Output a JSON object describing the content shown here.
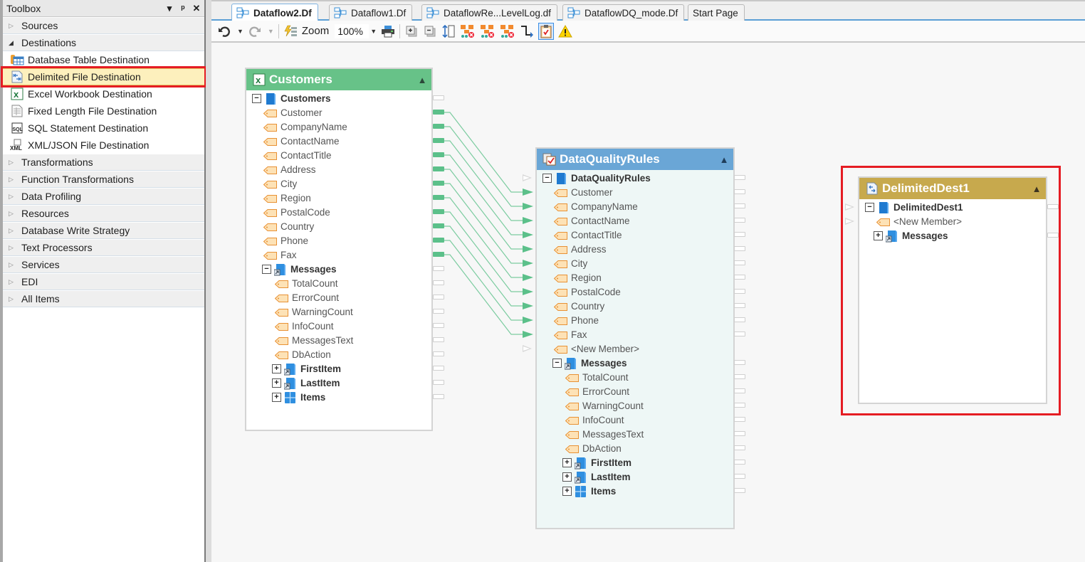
{
  "toolbox": {
    "title": "Toolbox",
    "header_buttons": [
      "dropdown",
      "pin",
      "close"
    ],
    "categories_before": [
      {
        "label": "Sources",
        "expanded": false
      },
      {
        "label": "Destinations",
        "expanded": true
      }
    ],
    "destination_items": [
      {
        "label": "Database Table Destination",
        "icon": "database-table-icon"
      },
      {
        "label": "Delimited File Destination",
        "icon": "delimited-file-icon",
        "selected": true
      },
      {
        "label": "Excel Workbook Destination",
        "icon": "excel-icon"
      },
      {
        "label": "Fixed Length File Destination",
        "icon": "fixed-length-file-icon"
      },
      {
        "label": "SQL Statement Destination",
        "icon": "sql-icon"
      },
      {
        "label": "XML/JSON File Destination",
        "icon": "xml-icon"
      }
    ],
    "categories_after": [
      {
        "label": "Transformations"
      },
      {
        "label": "Function Transformations"
      },
      {
        "label": "Data Profiling"
      },
      {
        "label": "Resources"
      },
      {
        "label": "Database Write Strategy"
      },
      {
        "label": "Text Processors"
      },
      {
        "label": "Services"
      },
      {
        "label": "EDI"
      },
      {
        "label": "All Items"
      }
    ]
  },
  "tabs": [
    {
      "label": "Dataflow2.Df",
      "active": true
    },
    {
      "label": "Dataflow1.Df"
    },
    {
      "label": "DataflowRe...LevelLog.df"
    },
    {
      "label": "DataflowDQ_mode.Df"
    },
    {
      "label": "Start Page"
    }
  ],
  "toolbar": {
    "zoom_label": "Zoom",
    "zoom_value": "100%",
    "buttons": [
      "undo",
      "redo",
      "auto-layout",
      "print",
      "expand-all",
      "collapse-all",
      "fit-height",
      "delete-links-1",
      "delete-links-2",
      "delete-links-3",
      "link-connector",
      "data-quality-mode",
      "warning"
    ]
  },
  "nodes": {
    "customers": {
      "title": "Customers",
      "root": "Customers",
      "fields": [
        "Customer",
        "CompanyName",
        "ContactName",
        "ContactTitle",
        "Address",
        "City",
        "Region",
        "PostalCode",
        "Country",
        "Phone",
        "Fax"
      ],
      "messages": {
        "label": "Messages",
        "fields": [
          "TotalCount",
          "ErrorCount",
          "WarningCount",
          "InfoCount",
          "MessagesText",
          "DbAction"
        ],
        "children": [
          "FirstItem",
          "LastItem",
          "Items"
        ]
      }
    },
    "dq": {
      "title": "DataQualityRules",
      "root": "DataQualityRules",
      "fields": [
        "Customer",
        "CompanyName",
        "ContactName",
        "ContactTitle",
        "Address",
        "City",
        "Region",
        "PostalCode",
        "Country",
        "Phone",
        "Fax"
      ],
      "new_member": "<New Member>",
      "messages": {
        "label": "Messages",
        "fields": [
          "TotalCount",
          "ErrorCount",
          "WarningCount",
          "InfoCount",
          "MessagesText",
          "DbAction"
        ],
        "children": [
          "FirstItem",
          "LastItem",
          "Items"
        ]
      }
    },
    "delimited": {
      "title": "DelimitedDest1",
      "root": "DelimitedDest1",
      "new_member": "<New Member>",
      "messages_label": "Messages"
    }
  },
  "links": [
    {
      "from": "Customers.Customer",
      "to": "DataQualityRules.Customer"
    },
    {
      "from": "Customers.CompanyName",
      "to": "DataQualityRules.CompanyName"
    },
    {
      "from": "Customers.ContactName",
      "to": "DataQualityRules.ContactName"
    },
    {
      "from": "Customers.ContactTitle",
      "to": "DataQualityRules.ContactTitle"
    },
    {
      "from": "Customers.Address",
      "to": "DataQualityRules.Address"
    },
    {
      "from": "Customers.City",
      "to": "DataQualityRules.City"
    },
    {
      "from": "Customers.Region",
      "to": "DataQualityRules.Region"
    },
    {
      "from": "Customers.PostalCode",
      "to": "DataQualityRules.PostalCode"
    },
    {
      "from": "Customers.Country",
      "to": "DataQualityRules.Country"
    },
    {
      "from": "Customers.Phone",
      "to": "DataQualityRules.Phone"
    },
    {
      "from": "Customers.Fax",
      "to": "DataQualityRules.Fax"
    }
  ],
  "colors": {
    "customers_header": "#67c288",
    "dq_header": "#6aa6d6",
    "delimited_header": "#c7a94d",
    "link": "#5cc08a",
    "highlight": "#e51c23",
    "selected_item": "#fdf0bd"
  }
}
